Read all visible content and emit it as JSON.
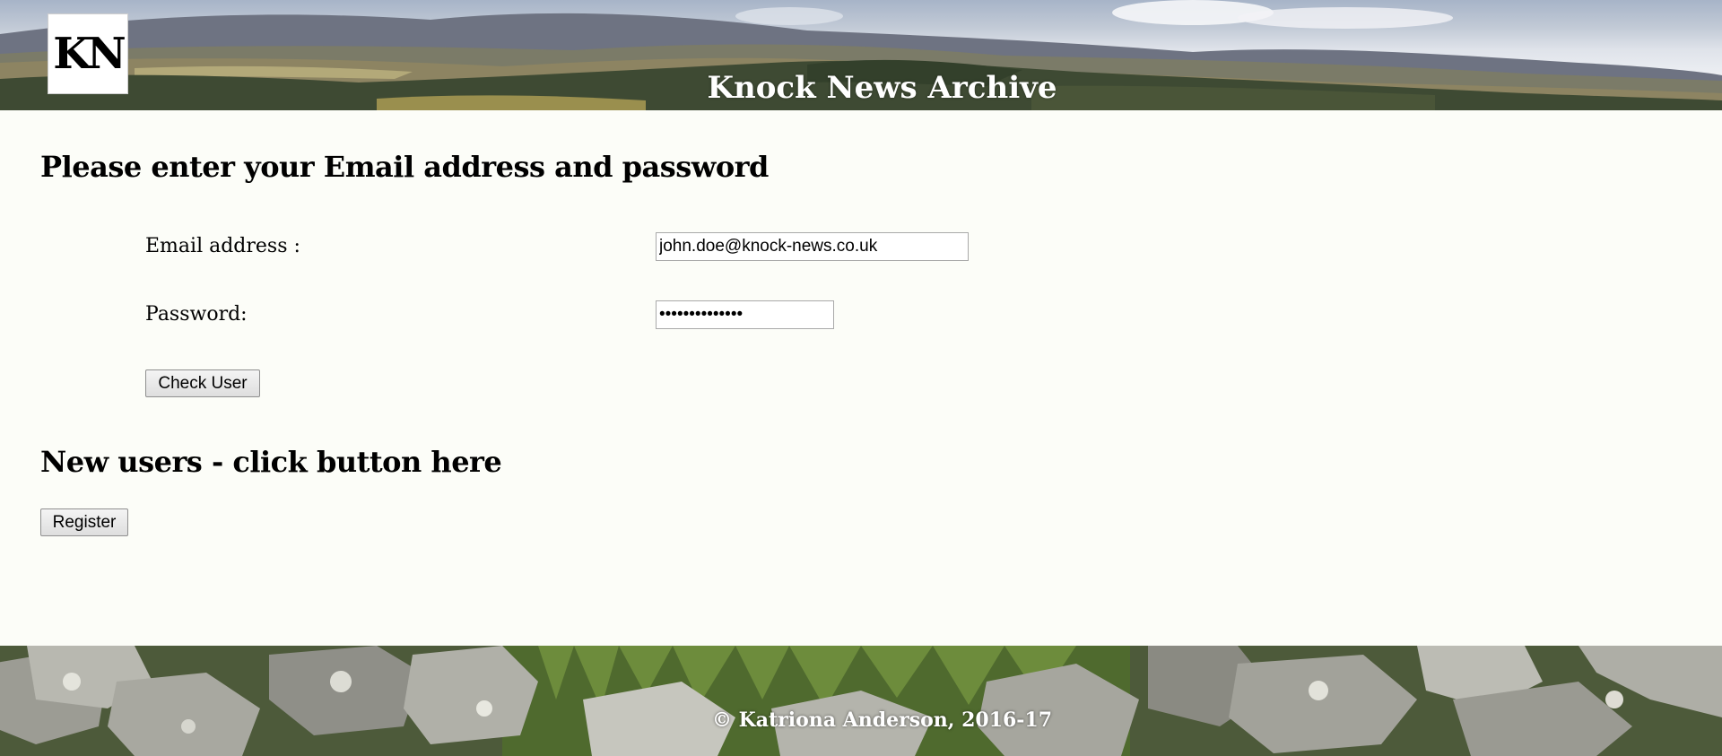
{
  "header": {
    "logo_text": "KN",
    "site_title": "Knock News Archive"
  },
  "login": {
    "heading": "Please enter your Email address and password",
    "email_label": "Email address :",
    "email_value": "john.doe@knock-news.co.uk",
    "password_label": "Password:",
    "password_value": "••••••••••••••",
    "check_user_label": "Check User"
  },
  "register": {
    "heading": "New users - click button here",
    "register_label": "Register"
  },
  "footer": {
    "copyright": "© Katriona Anderson, 2016-17"
  },
  "colors": {
    "page_background": "#fcfdf8",
    "heading_text": "#000000",
    "banner_text": "#ffffff"
  }
}
